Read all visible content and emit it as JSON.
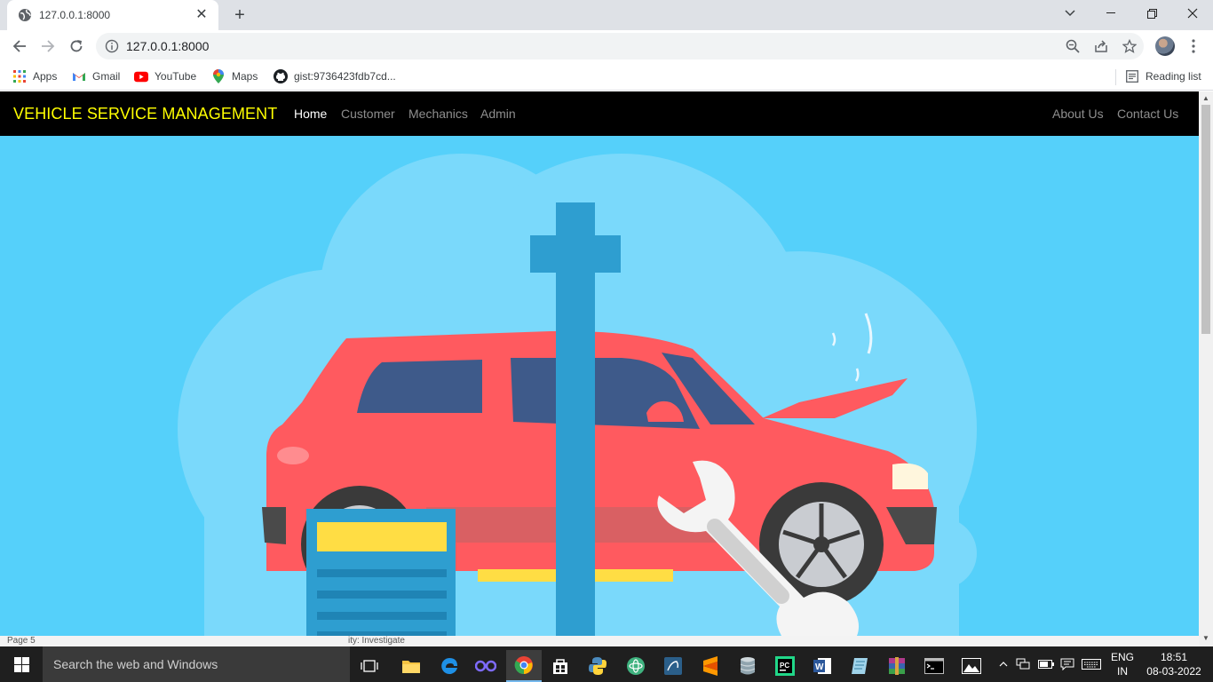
{
  "browser": {
    "tab_title": "127.0.0.1:8000",
    "url": "127.0.0.1:8000",
    "bookmarks": [
      {
        "label": "Apps",
        "icon": "apps-grid-icon"
      },
      {
        "label": "Gmail",
        "icon": "gmail-icon"
      },
      {
        "label": "YouTube",
        "icon": "youtube-icon"
      },
      {
        "label": "Maps",
        "icon": "maps-icon"
      },
      {
        "label": "gist:9736423fdb7cd...",
        "icon": "github-icon"
      }
    ],
    "reading_list": "Reading list"
  },
  "site": {
    "brand": "VEHICLE SERVICE MANAGEMENT",
    "nav": [
      {
        "label": "Home",
        "active": true
      },
      {
        "label": "Customer",
        "active": false
      },
      {
        "label": "Mechanics",
        "active": false
      },
      {
        "label": "Admin",
        "active": false
      }
    ],
    "nav_right": [
      {
        "label": "About Us"
      },
      {
        "label": "Contact Us"
      }
    ],
    "hero": {
      "background": "#55d0fa",
      "car_color": "#ff5a5f",
      "lift_color": "#2e9ed0"
    }
  },
  "statusstrip": {
    "left": "Page 5",
    "mid": "ity: Investigate"
  },
  "taskbar": {
    "search_placeholder": "Search the web and Windows",
    "lang_line1": "ENG",
    "lang_line2": "IN",
    "time": "18:51",
    "date": "08-03-2022"
  }
}
